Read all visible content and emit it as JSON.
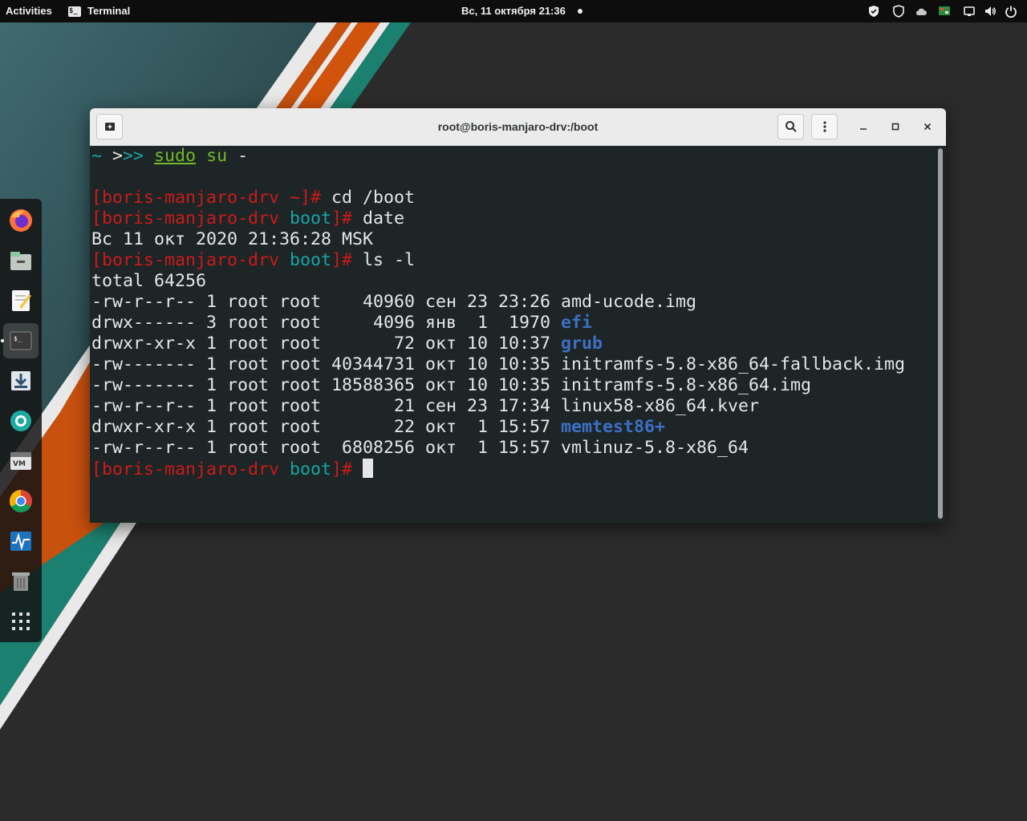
{
  "topbar": {
    "activities": "Activities",
    "app_name": "Terminal",
    "app_icon_glyph": "$_",
    "clock": "Вс, 11 октября  21:36"
  },
  "tray": [
    "shield-check-icon",
    "shield-icon",
    "cloud-icon",
    "update-indicator-icon",
    "display-icon",
    "volume-icon",
    "power-icon"
  ],
  "dock": [
    {
      "name": "firefox",
      "icon": "firefox-icon",
      "color": "#ff7139"
    },
    {
      "name": "files",
      "icon": "files-icon",
      "color": "#8fc7a0"
    },
    {
      "name": "text-editor",
      "icon": "text-editor-icon",
      "color": "#f2c94c"
    },
    {
      "name": "terminal",
      "icon": "terminal-icon",
      "color": "#3a3a3a",
      "active": true
    },
    {
      "name": "downloader",
      "icon": "download-icon",
      "color": "#4a9fd8"
    },
    {
      "name": "shutter",
      "icon": "camera-aperture-icon",
      "color": "#1eaaa0"
    },
    {
      "name": "vmware",
      "icon": "vmware-icon",
      "color": "#dddddd"
    },
    {
      "name": "chrome",
      "icon": "chrome-icon",
      "color": "#4285f4"
    },
    {
      "name": "system-monitor",
      "icon": "system-monitor-icon",
      "color": "#1e73be"
    },
    {
      "name": "trash",
      "icon": "trash-icon",
      "color": "#9a9a9a"
    },
    {
      "name": "app-grid",
      "icon": "app-grid-icon",
      "color": "#e0e0e0"
    }
  ],
  "window": {
    "title": "root@boris-manjaro-drv:/boot"
  },
  "terminal": {
    "lines": [
      [
        {
          "t": "~ ",
          "c": "c-teal"
        },
        {
          "t": ">",
          "c": ""
        },
        {
          "t": ">> ",
          "c": "c-teal"
        },
        {
          "t": "sudo",
          "c": "c-green u"
        },
        {
          "t": " ",
          "c": ""
        },
        {
          "t": "su",
          "c": "c-green"
        },
        {
          "t": " -",
          "c": ""
        }
      ],
      [],
      [
        {
          "t": "[boris-manjaro-drv ~]#",
          "c": "c-red"
        },
        {
          "t": " cd /boot",
          "c": ""
        }
      ],
      [
        {
          "t": "[boris-manjaro-drv ",
          "c": "c-red"
        },
        {
          "t": "boot",
          "c": "c-teal"
        },
        {
          "t": "]#",
          "c": "c-red"
        },
        {
          "t": " date",
          "c": ""
        }
      ],
      [
        {
          "t": "Вс 11 окт 2020 21:36:28 MSK",
          "c": ""
        }
      ],
      [
        {
          "t": "[boris-manjaro-drv ",
          "c": "c-red"
        },
        {
          "t": "boot",
          "c": "c-teal"
        },
        {
          "t": "]#",
          "c": "c-red"
        },
        {
          "t": " ls -l",
          "c": ""
        }
      ],
      [
        {
          "t": "total 64256",
          "c": ""
        }
      ],
      [
        {
          "t": "-rw-r--r-- 1 root root    40960 сен 23 23:26 ",
          "c": ""
        },
        {
          "t": "amd-ucode.img",
          "c": ""
        }
      ],
      [
        {
          "t": "drwx------ 3 root root     4096 янв  1  1970 ",
          "c": ""
        },
        {
          "t": "efi",
          "c": "c-blue"
        }
      ],
      [
        {
          "t": "drwxr-xr-x 1 root root       72 окт 10 10:37 ",
          "c": ""
        },
        {
          "t": "grub",
          "c": "c-blue"
        }
      ],
      [
        {
          "t": "-rw------- 1 root root 40344731 окт 10 10:35 ",
          "c": ""
        },
        {
          "t": "initramfs-5.8-x86_64-fallback.img",
          "c": ""
        }
      ],
      [
        {
          "t": "-rw------- 1 root root 18588365 окт 10 10:35 ",
          "c": ""
        },
        {
          "t": "initramfs-5.8-x86_64.img",
          "c": ""
        }
      ],
      [
        {
          "t": "-rw-r--r-- 1 root root       21 сен 23 17:34 ",
          "c": ""
        },
        {
          "t": "linux58-x86_64.kver",
          "c": ""
        }
      ],
      [
        {
          "t": "drwxr-xr-x 1 root root       22 окт  1 15:57 ",
          "c": ""
        },
        {
          "t": "memtest86+",
          "c": "c-blue"
        }
      ],
      [
        {
          "t": "-rw-r--r-- 1 root root  6808256 окт  1 15:57 ",
          "c": ""
        },
        {
          "t": "vmlinuz-5.8-x86_64",
          "c": ""
        }
      ],
      [
        {
          "t": "[boris-manjaro-drv ",
          "c": "c-red"
        },
        {
          "t": "boot",
          "c": "c-teal"
        },
        {
          "t": "]#",
          "c": "c-red"
        },
        {
          "t": " ",
          "c": ""
        }
      ]
    ]
  },
  "colors": {
    "terminal_bg": "#1e2526",
    "prompt_red": "#cc1a1a",
    "prompt_teal": "#17a5a5",
    "command_green": "#74b82b",
    "directory_blue": "#3d6fc4"
  }
}
